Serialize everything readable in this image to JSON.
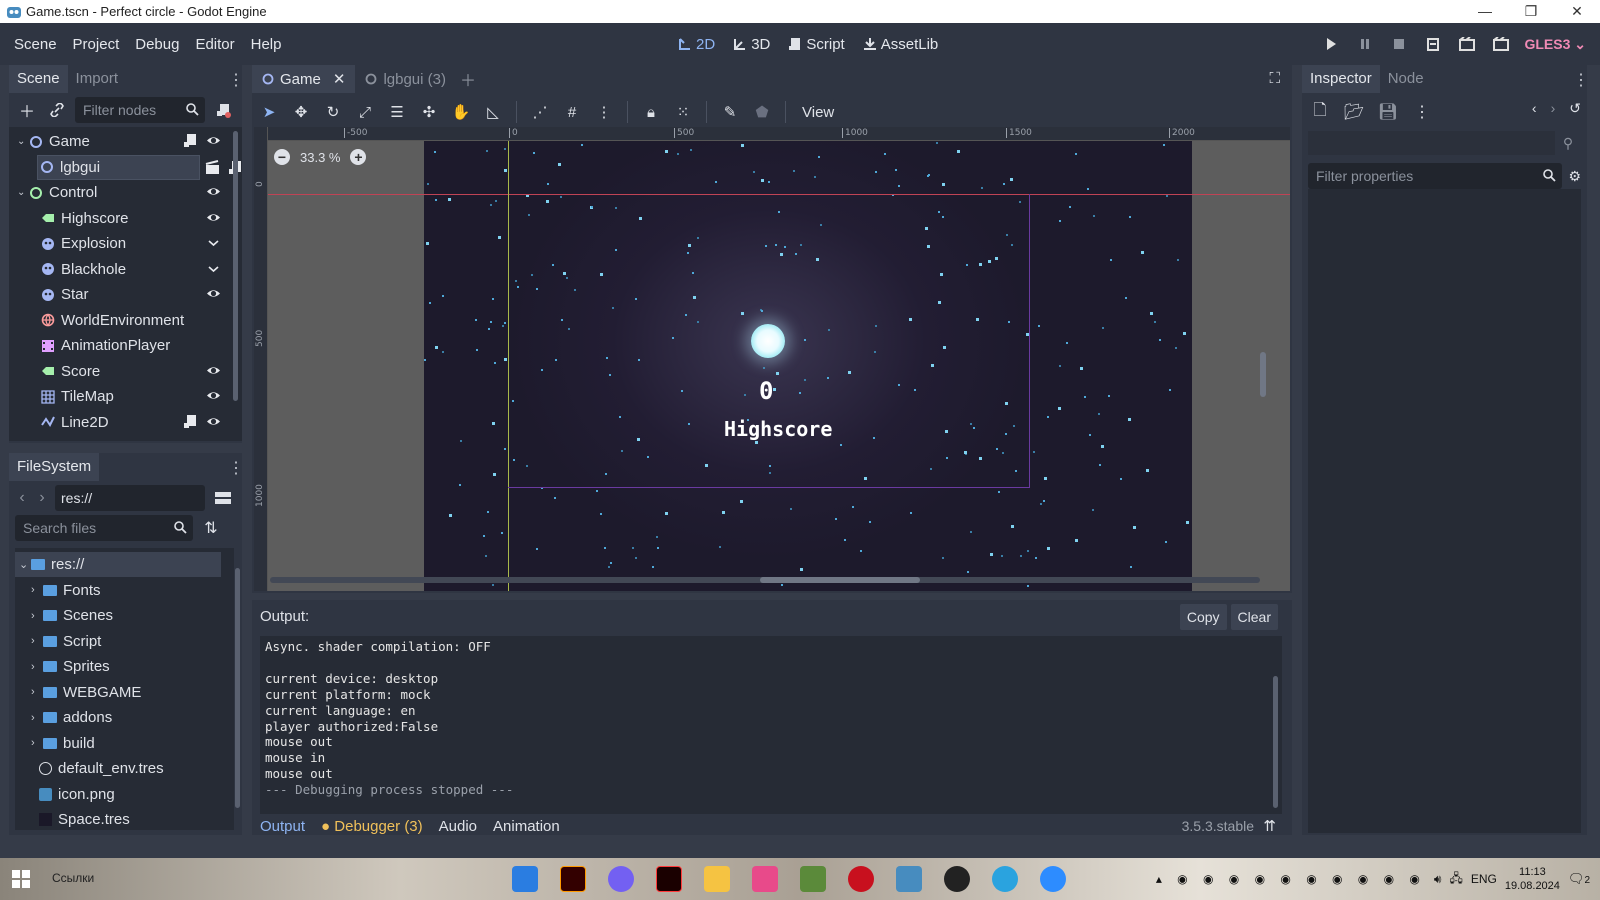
{
  "window": {
    "title": "Game.tscn - Perfect circle - Godot Engine",
    "controls": [
      "—",
      "❐",
      "✕"
    ]
  },
  "menu": {
    "items": [
      "Scene",
      "Project",
      "Debug",
      "Editor",
      "Help"
    ],
    "workspaces": {
      "w2d": "2D",
      "w3d": "3D",
      "script": "Script",
      "assetlib": "AssetLib"
    },
    "renderer": "GLES3"
  },
  "scene_dock": {
    "tabs": {
      "scene": "Scene",
      "import": "Import"
    },
    "filter_placeholder": "Filter nodes",
    "nodes": [
      {
        "label": "Game",
        "icon": "node2d-icon",
        "color": "#a5b7f3"
      },
      {
        "label": "lgbgui",
        "icon": "node2d-icon",
        "color": "#a5b7f3"
      },
      {
        "label": "Control",
        "icon": "control-icon",
        "color": "#a5efac"
      },
      {
        "label": "Highscore",
        "icon": "label-icon",
        "color": "#a5efac"
      },
      {
        "label": "Explosion",
        "icon": "particles-icon",
        "color": "#a5b7f3"
      },
      {
        "label": "Blackhole",
        "icon": "particles-icon",
        "color": "#a5b7f3"
      },
      {
        "label": "Star",
        "icon": "particles-icon",
        "color": "#a5b7f3"
      },
      {
        "label": "WorldEnvironment",
        "icon": "world-environment-icon",
        "color": "#fc9c9c"
      },
      {
        "label": "AnimationPlayer",
        "icon": "animation-player-icon",
        "color": "#e0a0ff"
      },
      {
        "label": "Score",
        "icon": "label-icon",
        "color": "#a5efac"
      },
      {
        "label": "TileMap",
        "icon": "tilemap-icon",
        "color": "#a5b7f3"
      },
      {
        "label": "Line2D",
        "icon": "line2d-icon",
        "color": "#a5b7f3"
      }
    ]
  },
  "filesystem": {
    "title": "FileSystem",
    "path": "res://",
    "search_placeholder": "Search files",
    "items": [
      {
        "label": "res://",
        "type": "folder"
      },
      {
        "label": "Fonts",
        "type": "folder"
      },
      {
        "label": "Scenes",
        "type": "folder"
      },
      {
        "label": "Script",
        "type": "folder"
      },
      {
        "label": "Sprites",
        "type": "folder"
      },
      {
        "label": "WEBGAME",
        "type": "folder"
      },
      {
        "label": "addons",
        "type": "folder"
      },
      {
        "label": "build",
        "type": "folder"
      },
      {
        "label": "default_env.tres",
        "type": "file"
      },
      {
        "label": "icon.png",
        "type": "file"
      },
      {
        "label": "Space.tres",
        "type": "file"
      }
    ]
  },
  "editor": {
    "scene_tabs": {
      "game": "Game",
      "lgbgui": "lgbgui (3)"
    },
    "view_menu": "View",
    "zoom": "33.3 %",
    "ruler_h": [
      "-500",
      "0",
      "500",
      "1000",
      "1500",
      "2000"
    ],
    "ruler_v": [
      "0",
      "500",
      "1000"
    ],
    "game_score": "0",
    "game_highscore_label": "Highscore"
  },
  "output": {
    "title": "Output:",
    "copy": "Copy",
    "clear": "Clear",
    "lines": [
      "Async. shader compilation: OFF",
      "",
      "current device: desktop",
      "current platform: mock",
      "current language: en",
      "player authorized:False",
      "mouse out",
      "mouse in",
      "mouse out"
    ],
    "stopped_line": "--- Debugging process stopped ---",
    "bottom_tabs": {
      "output": "Output",
      "debugger": "Debugger (3)",
      "audio": "Audio",
      "animation": "Animation"
    },
    "version": "3.5.3.stable"
  },
  "inspector": {
    "tabs": {
      "inspector": "Inspector",
      "node": "Node"
    },
    "filter_placeholder": "Filter properties"
  },
  "taskbar": {
    "links": "Ссылки",
    "lang": "ENG",
    "time": "11:13",
    "date": "19.08.2024",
    "notifications": "2"
  }
}
